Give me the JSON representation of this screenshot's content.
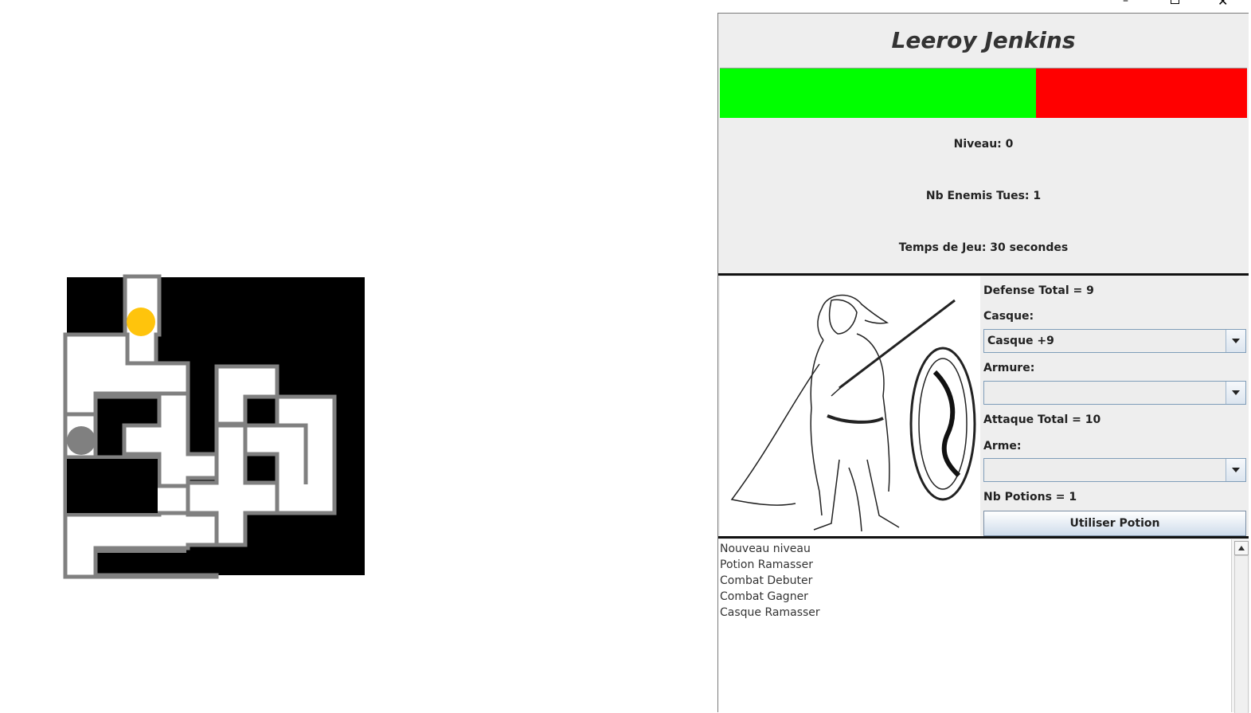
{
  "window": {
    "minimize_glyph": "–",
    "close_glyph": "✕"
  },
  "player": {
    "name": "Leeroy Jenkins",
    "health_fraction": 0.6,
    "health_color": "#00ff00",
    "missing_color": "#ff0000"
  },
  "stats": {
    "level": "Niveau: 0",
    "enemies_killed": "Nb Enemis Tues: 1",
    "play_time": "Temps de Jeu: 30 secondes"
  },
  "equipment": {
    "defense_total": "Defense Total = 9",
    "helmet_label": "Casque:",
    "helmet_value": "Casque +9",
    "armor_label": "Armure:",
    "armor_value": "",
    "attack_total": "Attaque Total = 10",
    "weapon_label": "Arme:",
    "weapon_value": "",
    "potions": "Nb Potions = 1",
    "use_potion_button": "Utiliser Potion"
  },
  "log": [
    "Nouveau niveau",
    "Potion Ramasser",
    "Combat Debuter",
    "Combat Gagner",
    "Casque Ramasser"
  ],
  "maze": {
    "wall_color": "#000000",
    "path_color": "#ffffff",
    "border_color": "#808080",
    "player_color": "#ffc40c",
    "enemy_color": "#808080"
  },
  "icons": {
    "hero_portrait": "hero-portrait-icon",
    "dropdown": "chevron-down-icon",
    "scroll_up": "chevron-up-icon"
  }
}
